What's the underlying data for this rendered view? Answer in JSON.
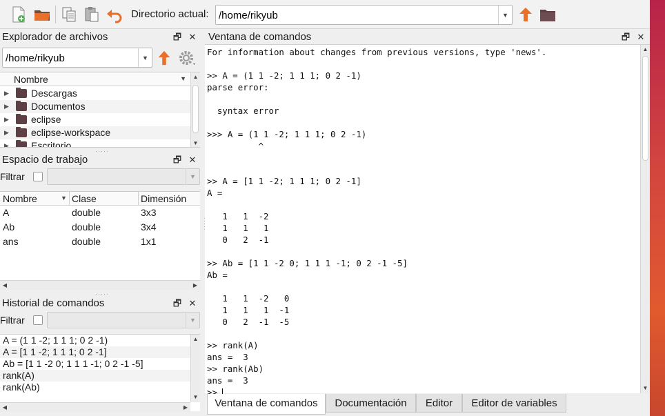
{
  "toolbar": {
    "dir_label": "Directorio actual:",
    "dir_value": "/home/rikyub",
    "icons": [
      "new-script-icon",
      "open-folder-icon",
      "copy-icon",
      "paste-icon",
      "undo-icon",
      "up-directory-icon",
      "browse-directory-icon"
    ]
  },
  "file_explorer": {
    "title": "Explorador de archivos",
    "path": "/home/rikyub",
    "column_name": "Nombre",
    "items": [
      "Descargas",
      "Documentos",
      "eclipse",
      "eclipse-workspace",
      "Escritorio"
    ]
  },
  "workspace": {
    "title": "Espacio de trabajo",
    "filter_label": "Filtrar",
    "columns": [
      "Nombre",
      "Clase",
      "Dimensión"
    ],
    "rows": [
      {
        "name": "A",
        "class": "double",
        "dim": "3x3"
      },
      {
        "name": "Ab",
        "class": "double",
        "dim": "3x4"
      },
      {
        "name": "ans",
        "class": "double",
        "dim": "1x1"
      }
    ]
  },
  "history": {
    "title": "Historial de comandos",
    "filter_label": "Filtrar",
    "items": [
      "A = (1 1 -2; 1 1 1; 0 2 -1)",
      "A = [1 1 -2; 1 1 1; 0 2 -1]",
      "Ab = [1 1 -2 0; 1 1 1 -1; 0 2 -1 -5]",
      "rank(A)",
      "rank(Ab)"
    ]
  },
  "command_window": {
    "title": "Ventana de comandos",
    "lines": [
      "For information about changes from previous versions, type 'news'.",
      "",
      ">> A = (1 1 -2; 1 1 1; 0 2 -1)",
      "parse error:",
      "",
      "  syntax error",
      "",
      ">>> A = (1 1 -2; 1 1 1; 0 2 -1)",
      "          ^",
      "",
      "",
      ">> A = [1 1 -2; 1 1 1; 0 2 -1]",
      "A =",
      "",
      "   1   1  -2",
      "   1   1   1",
      "   0   2  -1",
      "",
      ">> Ab = [1 1 -2 0; 1 1 1 -1; 0 2 -1 -5]",
      "Ab =",
      "",
      "   1   1  -2   0",
      "   1   1   1  -1",
      "   0   2  -1  -5",
      "",
      ">> rank(A)",
      "ans =  3",
      ">> rank(Ab)",
      "ans =  3"
    ],
    "prompt": ">> "
  },
  "tabs": [
    "Ventana de comandos",
    "Documentación",
    "Editor",
    "Editor de variables"
  ],
  "colors": {
    "folder": "#5d4045",
    "up_arrow": "#e8702a",
    "desktop_accent": "#d2453f"
  }
}
